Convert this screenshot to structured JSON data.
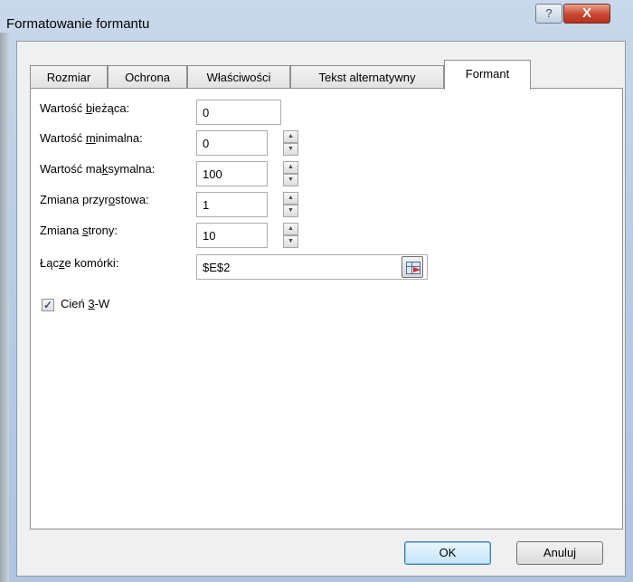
{
  "window": {
    "title": "Formatowanie formantu",
    "help_glyph": "?",
    "close_glyph": "X"
  },
  "tabs": [
    {
      "label": "Rozmiar"
    },
    {
      "label": "Ochrona"
    },
    {
      "label": "Właściwości"
    },
    {
      "label": "Tekst alternatywny"
    },
    {
      "label": "Formant",
      "active": true
    }
  ],
  "form": {
    "current_value": {
      "label_pre": "Wartość ",
      "label_u": "b",
      "label_post": "ieżąca:",
      "value": "0"
    },
    "min_value": {
      "label_pre": "Wartość ",
      "label_u": "m",
      "label_post": "inimalna:",
      "value": "0"
    },
    "max_value": {
      "label_pre": "Wartość ma",
      "label_u": "k",
      "label_post": "symalna:",
      "value": "100"
    },
    "increment": {
      "label_pre": "Zmiana przyr",
      "label_u": "o",
      "label_post": "stowa:",
      "value": "1"
    },
    "page_change": {
      "label_pre": "Zmiana ",
      "label_u": "s",
      "label_post": "trony:",
      "value": "10"
    },
    "cell_link": {
      "label_pre": "Łąc",
      "label_u": "z",
      "label_post": "e komórki:",
      "value": "$E$2"
    },
    "shadow_3d": {
      "label_pre": "Cień ",
      "label_u": "3",
      "label_post": "-W",
      "checked": true,
      "check_glyph": "✓"
    }
  },
  "spinner": {
    "up_glyph": "▲",
    "down_glyph": "▼"
  },
  "buttons": {
    "ok": "OK",
    "cancel": "Anuluj"
  }
}
